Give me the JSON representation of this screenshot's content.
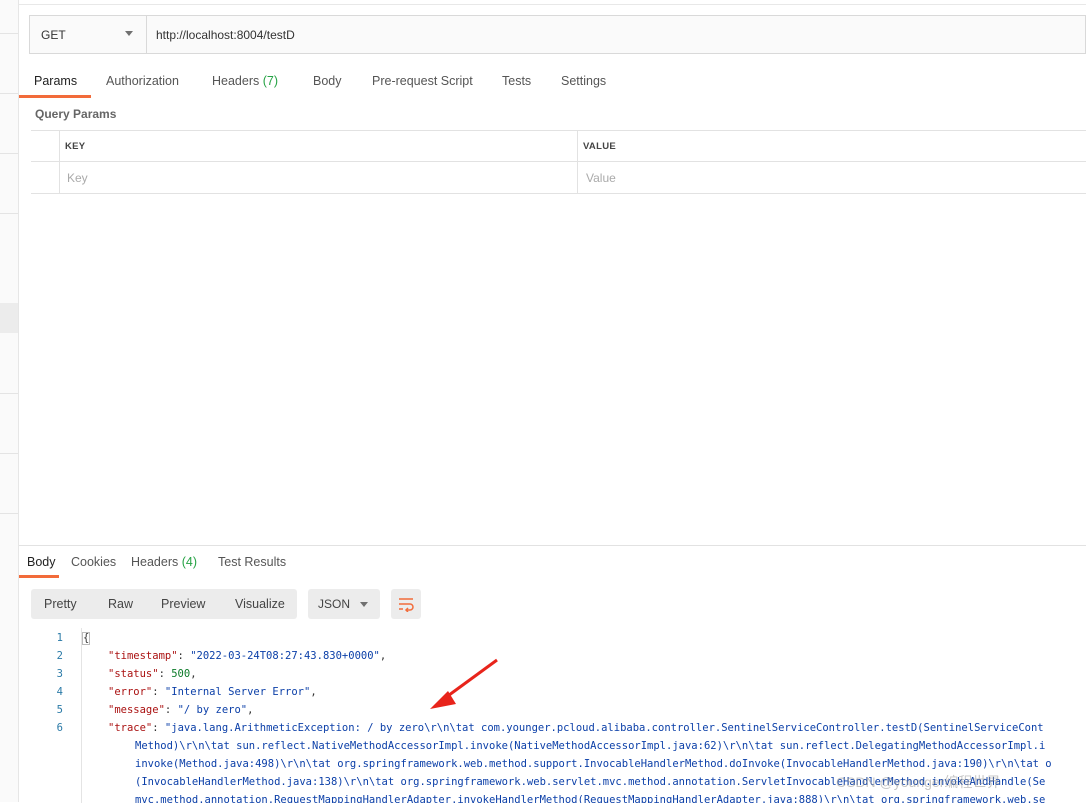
{
  "request": {
    "method": "GET",
    "url": "http://localhost:8004/testD"
  },
  "request_tabs": [
    {
      "label": "Params",
      "count": ""
    },
    {
      "label": "Authorization",
      "count": ""
    },
    {
      "label": "Headers",
      "count": "(7)"
    },
    {
      "label": "Body",
      "count": ""
    },
    {
      "label": "Pre-request Script",
      "count": ""
    },
    {
      "label": "Tests",
      "count": ""
    },
    {
      "label": "Settings",
      "count": ""
    }
  ],
  "query_params": {
    "title": "Query Params",
    "key_header": "KEY",
    "value_header": "VALUE",
    "key_placeholder": "Key",
    "value_placeholder": "Value"
  },
  "response_tabs": [
    {
      "label": "Body",
      "count": ""
    },
    {
      "label": "Cookies",
      "count": ""
    },
    {
      "label": "Headers",
      "count": "(4)"
    },
    {
      "label": "Test Results",
      "count": ""
    }
  ],
  "view_modes": [
    "Pretty",
    "Raw",
    "Preview",
    "Visualize"
  ],
  "format": "JSON",
  "code": {
    "line_numbers": [
      "1",
      "2",
      "3",
      "4",
      "5",
      "6"
    ],
    "open_brace": "{",
    "timestamp_key": "\"timestamp\"",
    "timestamp_val": "\"2022-03-24T08:27:43.830+0000\"",
    "status_key": "\"status\"",
    "status_val": "500",
    "error_key": "\"error\"",
    "error_val": "\"Internal Server Error\"",
    "message_key": "\"message\"",
    "message_val": "\"/ by zero\"",
    "trace_key": "\"trace\"",
    "trace_lines": [
      "\"java.lang.ArithmeticException: / by zero\\r\\n\\tat com.younger.pcloud.alibaba.controller.SentinelServiceController.testD(SentinelServiceCont",
      "Method)\\r\\n\\tat sun.reflect.NativeMethodAccessorImpl.invoke(NativeMethodAccessorImpl.java:62)\\r\\n\\tat sun.reflect.DelegatingMethodAccessorImpl.i",
      "invoke(Method.java:498)\\r\\n\\tat org.springframework.web.method.support.InvocableHandlerMethod.doInvoke(InvocableHandlerMethod.java:190)\\r\\n\\tat o",
      "(InvocableHandlerMethod.java:138)\\r\\n\\tat org.springframework.web.servlet.mvc.method.annotation.ServletInvocableHandlerMethod.invokeAndHandle(Se",
      "mvc.method.annotation.RequestMappingHandlerAdapter.invokeHandlerMethod(RequestMappingHandlerAdapter.java:888)\\r\\n\\tat org.springframework.web.se"
    ]
  },
  "watermark": "CSDN @younger编程世界",
  "colors": {
    "accent": "#f26b3a",
    "count_green": "#25a244",
    "json_key": "#a11111",
    "json_string": "#0b3fa8",
    "json_number": "#0b7a28",
    "arrow": "#e8241b"
  }
}
